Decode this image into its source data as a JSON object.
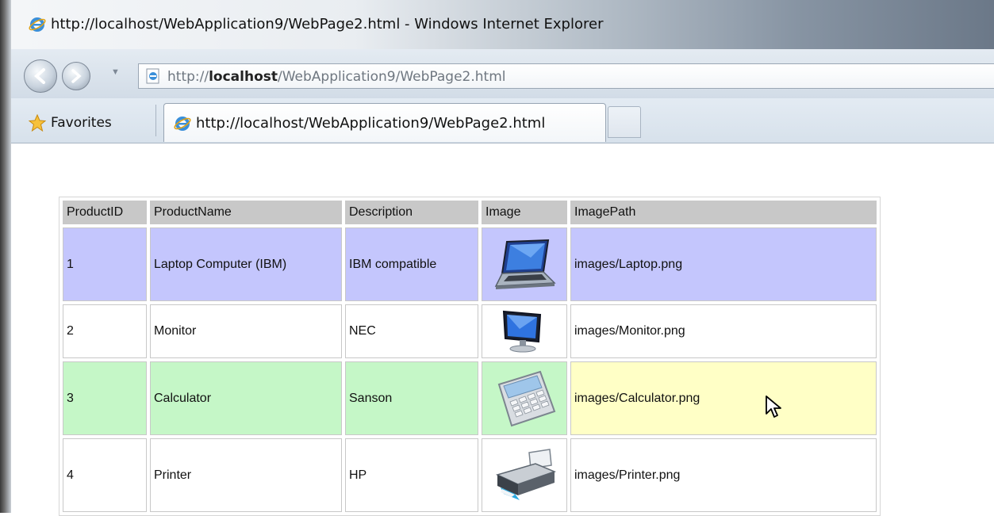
{
  "window": {
    "title": "http://localhost/WebApplication9/WebPage2.html - Windows Internet Explorer"
  },
  "navbar": {
    "address_prefix": "http://",
    "address_host": "localhost",
    "address_path": "/WebApplication9/WebPage2.html"
  },
  "tabbar": {
    "favorites_label": "Favorites",
    "tab_label": "http://localhost/WebApplication9/WebPage2.html"
  },
  "table": {
    "headers": [
      "ProductID",
      "ProductName",
      "Description",
      "Image",
      "ImagePath"
    ],
    "rows": [
      {
        "id": "1",
        "name": "Laptop Computer (IBM)",
        "description": "IBM compatible",
        "image_icon": "laptop-icon",
        "path": "images/Laptop.png",
        "color": "#c4c6fd"
      },
      {
        "id": "2",
        "name": "Monitor",
        "description": "NEC",
        "image_icon": "monitor-icon",
        "path": "images/Monitor.png",
        "color": "#ffffff"
      },
      {
        "id": "3",
        "name": "Calculator",
        "description": "Sanson",
        "image_icon": "calculator-icon",
        "path": "images/Calculator.png",
        "color": "#c5f7c7",
        "hover_color": "#ffffc6"
      },
      {
        "id": "4",
        "name": "Printer",
        "description": "HP",
        "image_icon": "printer-icon",
        "path": "images/Printer.png",
        "color": "#ffffff"
      }
    ]
  },
  "icons": {
    "title": "ie-icon",
    "back": "back-arrow-icon",
    "forward": "forward-arrow-icon",
    "favorites": "star-icon",
    "cursor": "mouse-pointer-icon"
  }
}
